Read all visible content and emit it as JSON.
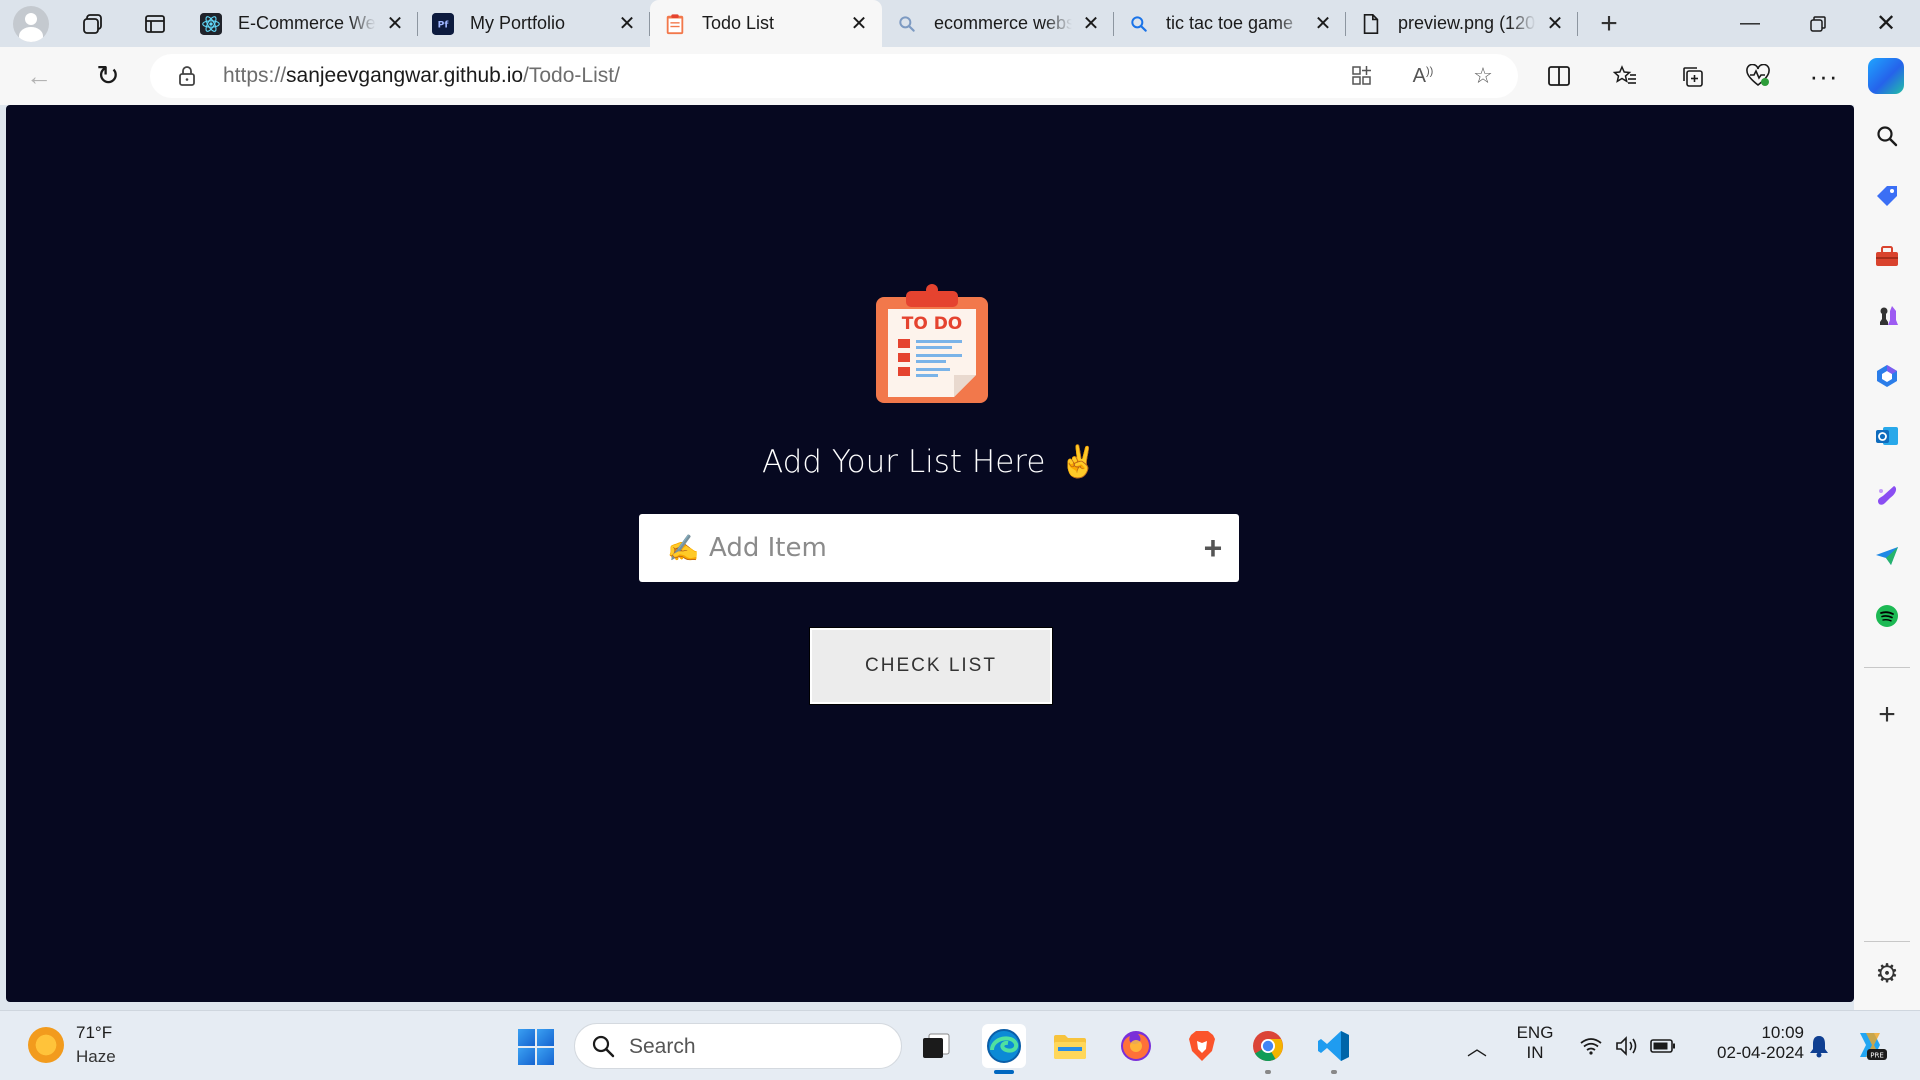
{
  "browser": {
    "tabs": [
      {
        "title": "E-Commerce Website",
        "icon": "react-icon",
        "active": false
      },
      {
        "title": "My Portfolio",
        "icon": "portfolio-icon",
        "active": false
      },
      {
        "title": "Todo List",
        "icon": "clipboard-icon",
        "active": true
      },
      {
        "title": "ecommerce website",
        "icon": "search-icon",
        "active": false
      },
      {
        "title": "tic tac toe game",
        "icon": "search-icon",
        "active": false
      },
      {
        "title": "preview.png (1200",
        "icon": "file-icon",
        "active": false
      }
    ],
    "url_scheme": "https://",
    "url_host": "sanjeevgangwar.github.io",
    "url_path": "/Todo-List/"
  },
  "page": {
    "logo_text": "TO DO",
    "heading": "Add Your List Here",
    "heading_emoji": "✌️",
    "input_emoji": "✍️",
    "input_placeholder": "Add Item",
    "add_symbol": "+",
    "check_button": "CHECK LIST"
  },
  "taskbar": {
    "weather_temp": "71°F",
    "weather_condition": "Haze",
    "search_label": "Search",
    "language_top": "ENG",
    "language_bottom": "IN",
    "time": "10:09",
    "date": "02-04-2024"
  },
  "colors": {
    "page_bg": "#060820",
    "logo_orange": "#f2784b",
    "logo_red": "#e5432f",
    "edge_blue": "#0067c0"
  }
}
